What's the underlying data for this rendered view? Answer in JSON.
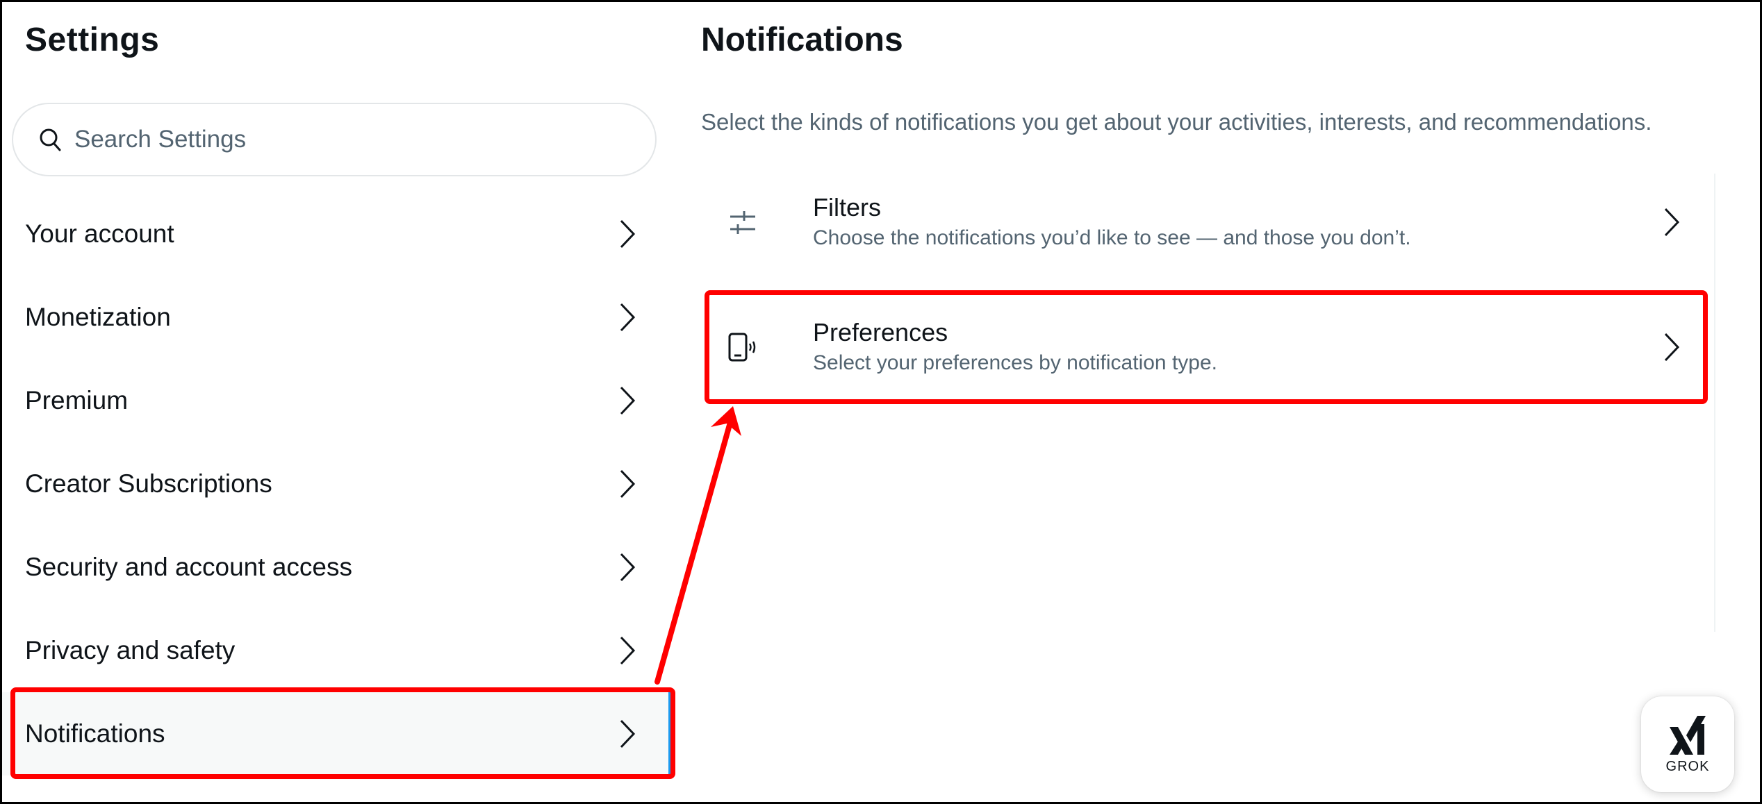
{
  "sidebar": {
    "title": "Settings",
    "search": {
      "placeholder": "Search Settings",
      "value": "",
      "icon": "search-icon"
    },
    "items": [
      {
        "label": "Your account",
        "active": false
      },
      {
        "label": "Monetization",
        "active": false
      },
      {
        "label": "Premium",
        "active": false
      },
      {
        "label": "Creator Subscriptions",
        "active": false
      },
      {
        "label": "Security and account access",
        "active": false
      },
      {
        "label": "Privacy and safety",
        "active": false
      },
      {
        "label": "Notifications",
        "active": true
      }
    ]
  },
  "main": {
    "title": "Notifications",
    "description": "Select the kinds of notifications you get about your activities, interests, and recommendations.",
    "rows": [
      {
        "icon": "filters-icon",
        "title": "Filters",
        "subtitle": "Choose the notifications you’d like to see — and those you don’t."
      },
      {
        "icon": "phone-vibrate-icon",
        "title": "Preferences",
        "subtitle": "Select your preferences by notification type."
      }
    ]
  },
  "grok": {
    "label": "GROK",
    "icon": "xai-logo-icon"
  },
  "colors": {
    "text_primary": "#0f1419",
    "text_secondary": "#536471",
    "accent": "#1d9bf0",
    "annotation": "#ff0000",
    "active_bg": "#f7f9f9"
  },
  "annotations": {
    "highlighted": [
      "Notifications",
      "Preferences"
    ],
    "arrow": "from Notifications to Preferences"
  }
}
